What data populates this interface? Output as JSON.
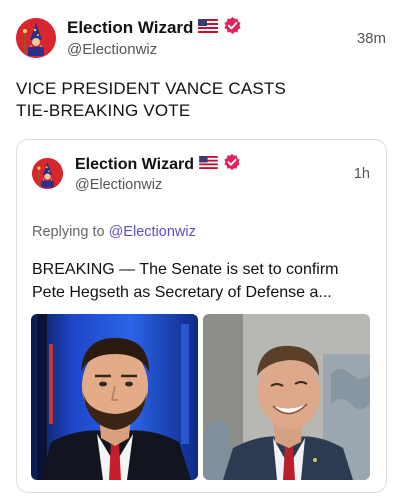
{
  "post": {
    "author_name": "Election Wizard",
    "handle": "@Electionwiz",
    "time": "38m",
    "text_lines": [
      "VICE PRESIDENT VANCE CASTS",
      "TIE-BREAKING VOTE"
    ]
  },
  "quoted": {
    "author_name": "Election Wizard",
    "handle": "@Electionwiz",
    "time": "1h",
    "reply_prefix": "Replying to",
    "reply_mention": "@Electionwiz",
    "text_lines": [
      "BREAKING — The Senate is set to confirm",
      "Pete Hegseth as Secretary of Defense a..."
    ]
  },
  "colors": {
    "avatar_bg": "#d8262e",
    "verified": "#e0245e",
    "mention": "#5a4fc9"
  },
  "icons": {
    "flag": "us-flag-icon",
    "verified": "verified-badge-icon"
  }
}
